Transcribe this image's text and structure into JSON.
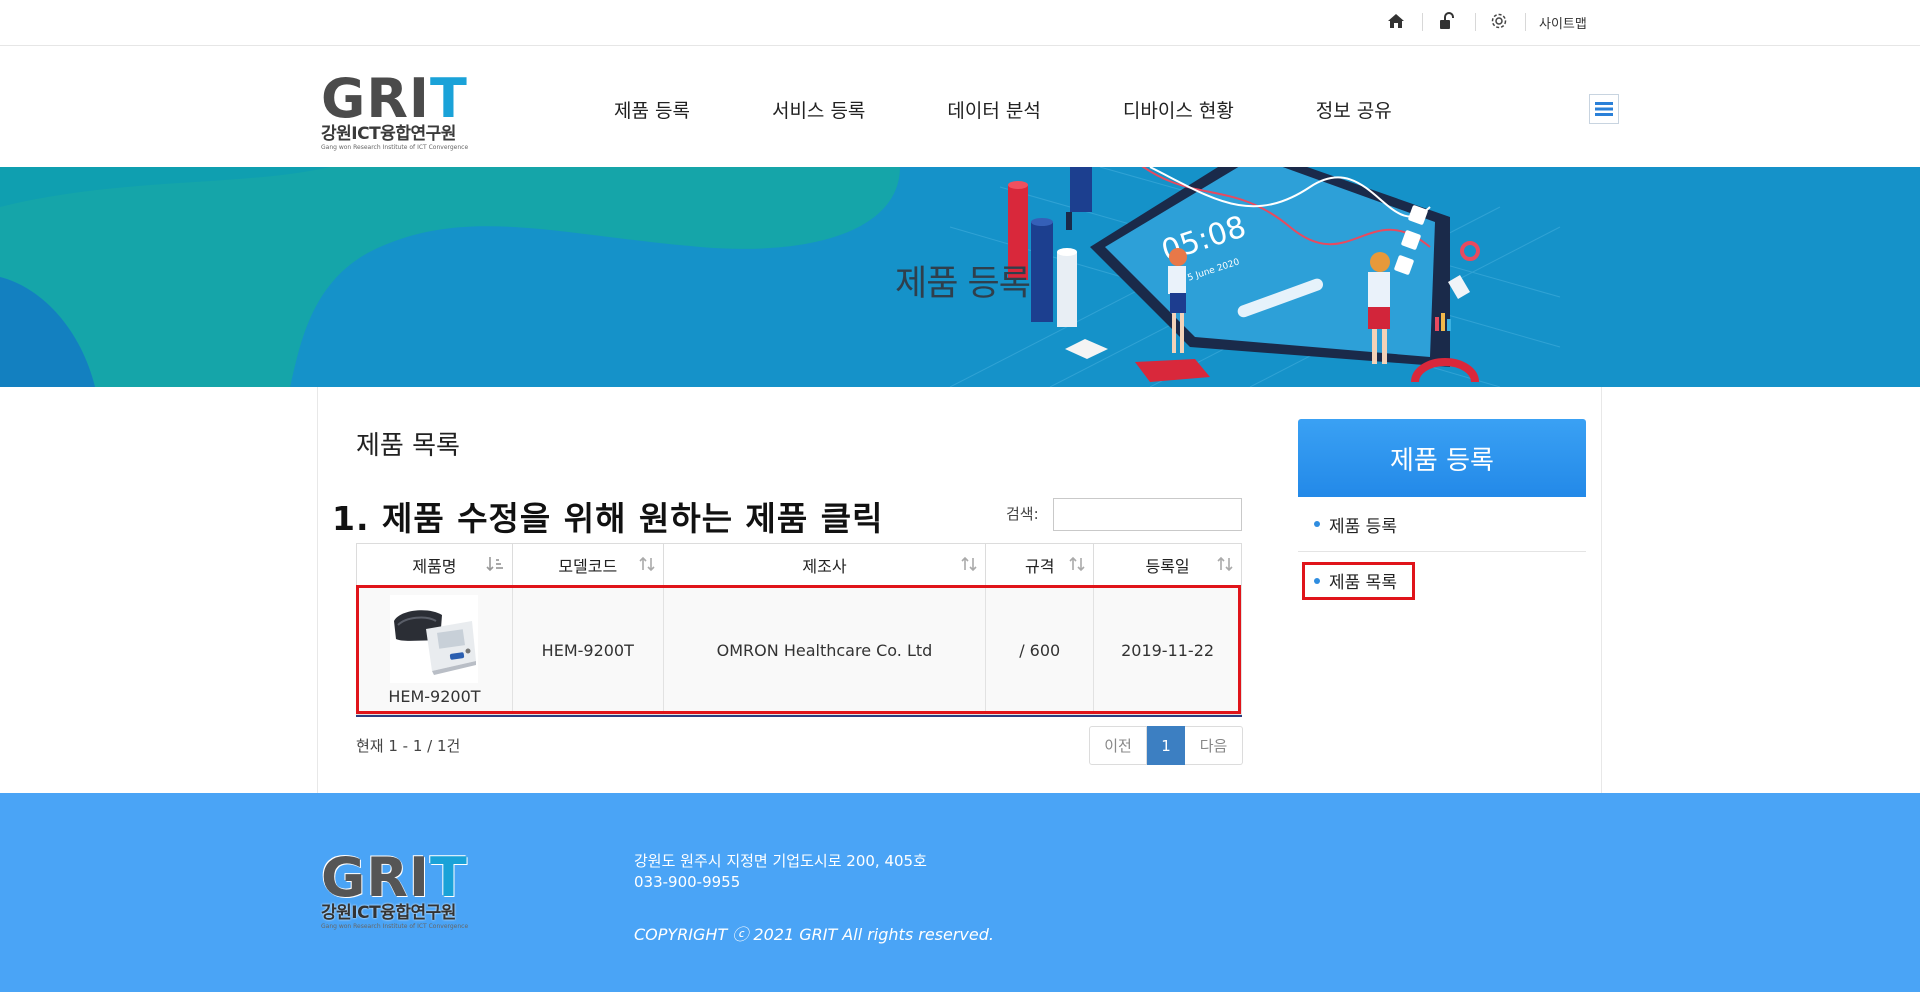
{
  "utility": {
    "icons": [
      "home-icon",
      "unlock-icon",
      "gear-icon"
    ],
    "sitemap_label": "사이트맵"
  },
  "logo": {
    "letters_gri": "GRI",
    "letter_t": "T",
    "subtitle": "강원ICT융합연구원",
    "tiny_text": "Gang won Research Institute of ICT Convergence"
  },
  "nav": {
    "items": [
      "제품 등록",
      "서비스 등록",
      "데이터 분석",
      "디바이스 현황",
      "정보 공유"
    ],
    "menu_icon": "hamburger-icon"
  },
  "banner": {
    "title": "제품 등록",
    "phone_time": "05:08",
    "phone_date": "5 June 2020"
  },
  "main": {
    "page_title": "제품 목록",
    "instruction": "1. 제품 수정을 위해 원하는 제품 클릭",
    "search_label": "검색:",
    "search_value": "",
    "columns": [
      "제품명",
      "모델코드",
      "제조사",
      "규격",
      "등록일"
    ],
    "rows": [
      {
        "product_name": "HEM-9200T",
        "model_code": "HEM-9200T",
        "manufacturer": "OMRON Healthcare Co. Ltd",
        "spec": "/ 600",
        "registered": "2019-11-22"
      }
    ],
    "count_text": "현재 1 - 1 / 1건",
    "pager": {
      "prev": "이전",
      "current": "1",
      "next": "다음"
    }
  },
  "side": {
    "title": "제품 등록",
    "items": [
      "제품 등록",
      "제품 목록"
    ]
  },
  "footer": {
    "address": "강원도 원주시 지정면 기업도시로 200, 405호",
    "tel": "033-900-9955",
    "copyright": "COPYRIGHT ⓒ 2021 GRIT All rights reserved."
  },
  "colors": {
    "accent_blue": "#2389e8",
    "footer_blue": "#4aa4f6",
    "highlight_red": "#e0141a",
    "pager_active": "#3c7fc2"
  }
}
